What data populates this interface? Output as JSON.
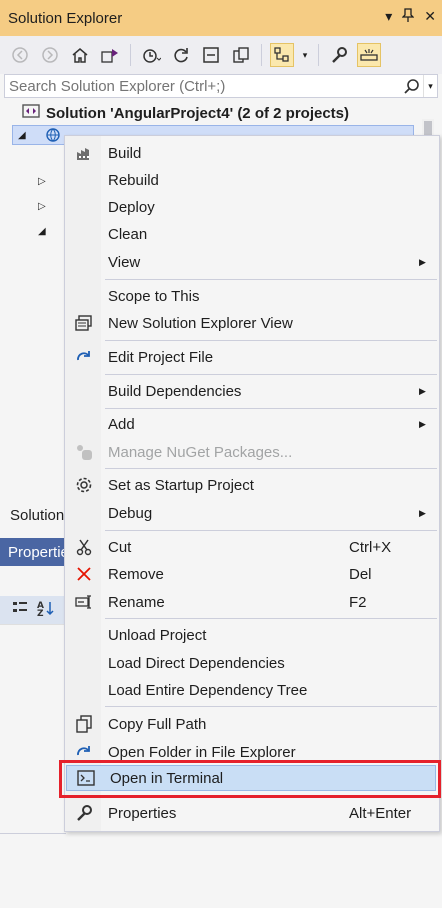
{
  "window": {
    "title": "Solution Explorer"
  },
  "search": {
    "placeholder": "Search Solution Explorer (Ctrl+;)"
  },
  "tree": {
    "solution_label": "Solution 'AngularProject4' (2 of 2 projects)"
  },
  "status": {
    "left_label": "Solution"
  },
  "properties_panel": {
    "title": "Properties"
  },
  "context_menu": {
    "items": [
      {
        "label": "Build",
        "icon": "build-icon"
      },
      {
        "label": "Rebuild"
      },
      {
        "label": "Deploy"
      },
      {
        "label": "Clean"
      },
      {
        "label": "View",
        "submenu": true
      },
      {
        "label": "Scope to This"
      },
      {
        "label": "New Solution Explorer View",
        "icon": "new-view-icon"
      },
      {
        "label": "Edit Project File",
        "icon": "edit-project-icon"
      },
      {
        "label": "Build Dependencies",
        "submenu": true
      },
      {
        "label": "Add",
        "submenu": true
      },
      {
        "label": "Manage NuGet Packages...",
        "icon": "nuget-icon",
        "disabled": true
      },
      {
        "label": "Set as Startup Project",
        "icon": "gear-icon"
      },
      {
        "label": "Debug",
        "submenu": true
      },
      {
        "label": "Cut",
        "shortcut": "Ctrl+X",
        "icon": "scissors-icon"
      },
      {
        "label": "Remove",
        "shortcut": "Del",
        "icon": "remove-x-icon"
      },
      {
        "label": "Rename",
        "shortcut": "F2",
        "icon": "rename-icon"
      },
      {
        "label": "Unload Project"
      },
      {
        "label": "Load Direct Dependencies"
      },
      {
        "label": "Load Entire Dependency Tree"
      },
      {
        "label": "Copy Full Path",
        "icon": "copy-icon"
      },
      {
        "label": "Open Folder in File Explorer",
        "icon": "open-folder-icon"
      },
      {
        "label": "Open in Terminal",
        "icon": "terminal-icon",
        "highlighted": true
      },
      {
        "label": "Properties",
        "shortcut": "Alt+Enter",
        "icon": "wrench-icon"
      }
    ]
  },
  "colors": {
    "title_bar": "#f5cc84",
    "highlight": "#c9def5",
    "annotation_red": "#e5212b",
    "properties_header": "#4a66a3"
  }
}
